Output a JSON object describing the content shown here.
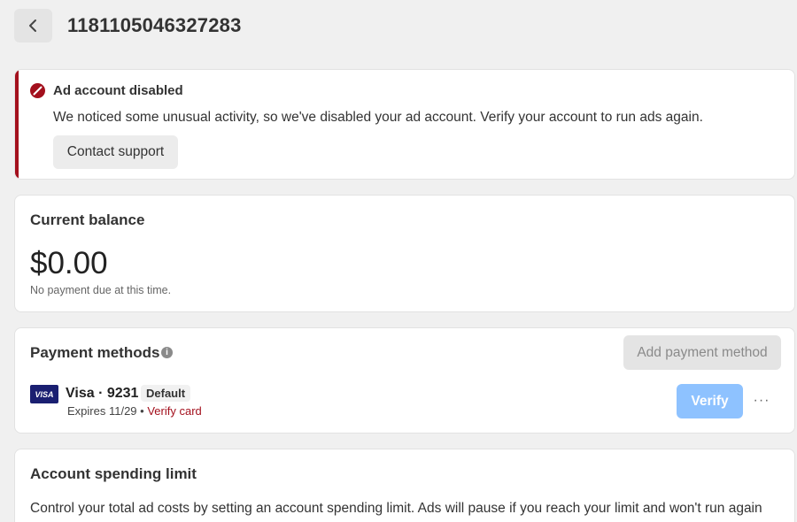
{
  "header": {
    "title": "1181105046327283"
  },
  "alert": {
    "title": "Ad account disabled",
    "message": "We noticed some unusual activity, so we've disabled your ad account. Verify your account to run ads again.",
    "button_label": "Contact support",
    "accent_color": "#a3101d"
  },
  "balance": {
    "title": "Current balance",
    "amount": "$0.00",
    "note": "No payment due at this time."
  },
  "payments": {
    "title": "Payment methods",
    "info_glyph": "i",
    "add_button_label": "Add payment method",
    "method": {
      "brand_logo": "VISA",
      "name": "Visa · 9231",
      "badge": "Default",
      "expires": "Expires 11/29",
      "separator": "•",
      "verify_link": "Verify card",
      "verify_button": "Verify",
      "more_label": "···"
    }
  },
  "spending": {
    "title": "Account spending limit",
    "description": "Control your total ad costs by setting an account spending limit. Ads will pause if you reach your limit and won't run again"
  }
}
